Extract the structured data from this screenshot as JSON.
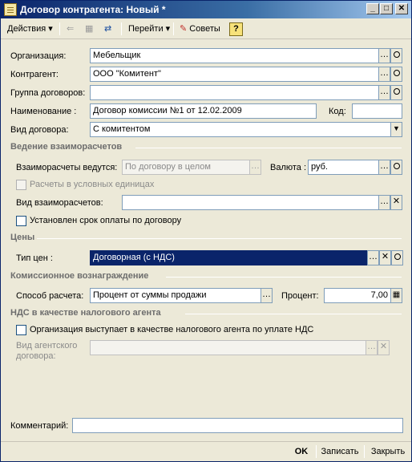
{
  "window": {
    "title": "Договор контрагента: Новый *"
  },
  "toolbar": {
    "actions": "Действия",
    "goto": "Перейти",
    "tips": "Советы",
    "help": "?"
  },
  "form": {
    "org_label": "Организация:",
    "org_value": "Мебельщик",
    "contractor_label": "Контрагент:",
    "contractor_value": "ООО \"Комитент\"",
    "group_label": "Группа договоров:",
    "group_value": "",
    "name_label": "Наименование :",
    "name_value": "Договор комиссии №1 от 12.02.2009",
    "code_label": "Код:",
    "code_value": "",
    "type_label": "Вид договора:",
    "type_value": "С комитентом"
  },
  "settlements": {
    "section": "Ведение взаиморасчетов",
    "conducted_label": "Взаиморасчеты ведутся:",
    "conducted_value": "По договору в целом",
    "currency_label": "Валюта :",
    "currency_value": "руб.",
    "cu_label": "Расчеты в условных единицах",
    "kind_label": "Вид взаиморасчетов:",
    "kind_value": "",
    "term_label": "Установлен срок оплаты по договору"
  },
  "prices": {
    "section": "Цены",
    "type_label": "Тип цен :",
    "type_value": "Договорная (с НДС)"
  },
  "commission": {
    "section": "Комиссионное вознаграждение",
    "method_label": "Способ расчета:",
    "method_value": "Процент от суммы продажи",
    "percent_label": "Процент:",
    "percent_value": "7,00"
  },
  "vat": {
    "section": "НДС в качестве налогового агента",
    "agent_label": "Организация выступает в качестве налогового агента по уплате НДС",
    "kind_label_1": "Вид агентского",
    "kind_label_2": "договора:",
    "kind_value": ""
  },
  "comment": {
    "label": "Комментарий:",
    "value": ""
  },
  "bottom": {
    "ok": "OK",
    "save": "Записать",
    "close": "Закрыть"
  }
}
